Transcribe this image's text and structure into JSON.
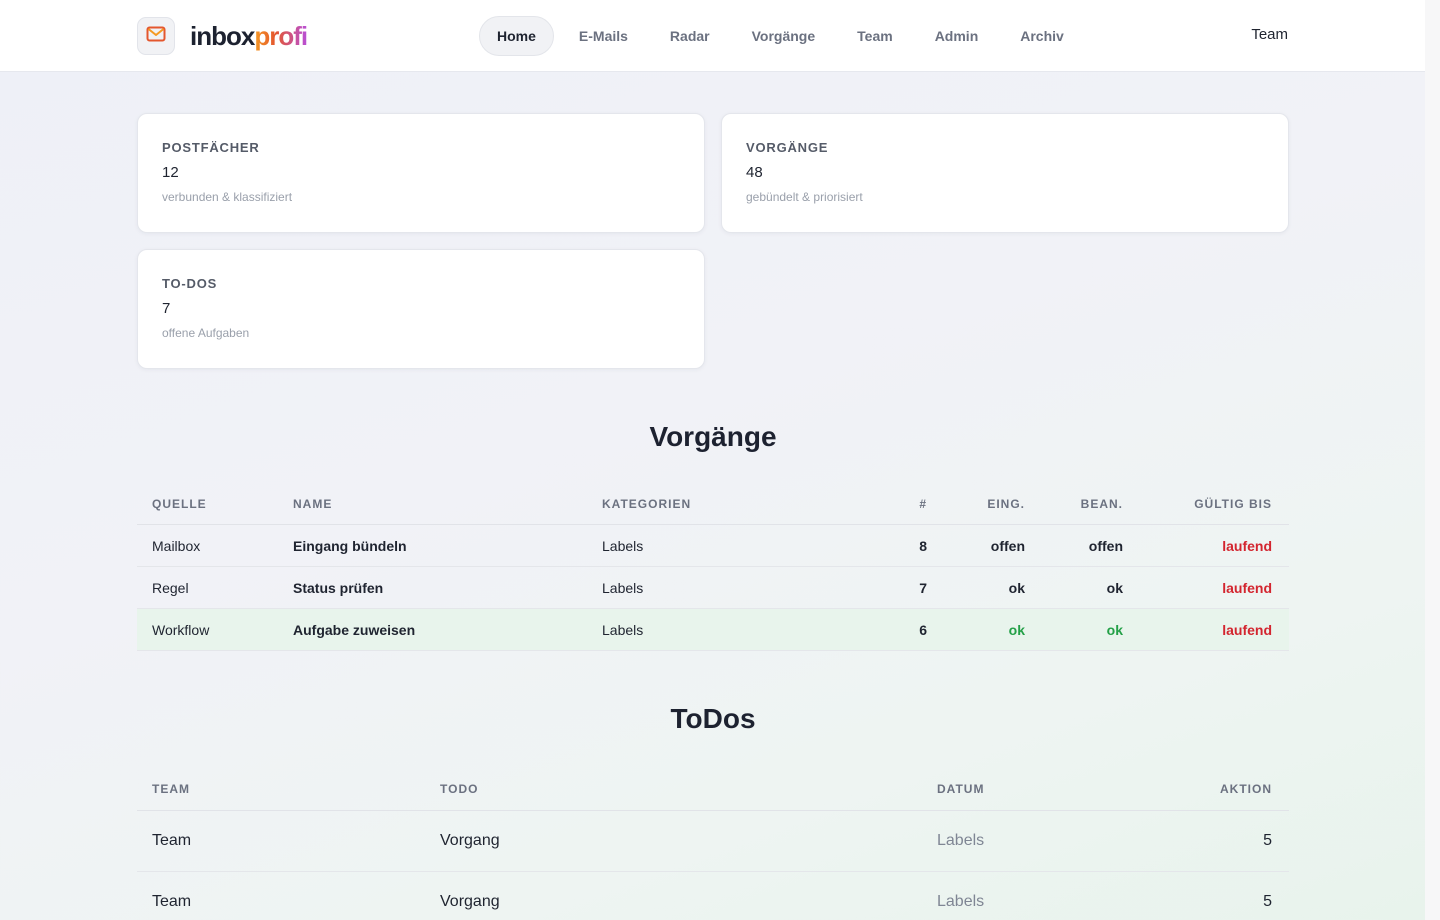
{
  "header": {
    "logo_part1": "inbox",
    "logo_part2": "profi",
    "nav": [
      "Home",
      "E-Mails",
      "Radar",
      "Vorgänge",
      "Team",
      "Admin",
      "Archiv"
    ],
    "active_nav": "Home",
    "right_link": "Team"
  },
  "icons": {
    "logo": "mail-icon"
  },
  "colors": {
    "accent_red": "#d3252f",
    "accent_green": "#23a047",
    "highlight_row": "#e8f4ec"
  },
  "cards": [
    {
      "title": "POSTFÄCHER",
      "value": "12",
      "subtitle": "verbunden & klassifiziert"
    },
    {
      "title": "VORGÄNGE",
      "value": "48",
      "subtitle": "gebündelt & priorisiert"
    },
    {
      "title": "TO-DOS",
      "value": "7",
      "subtitle": "offene Aufgaben"
    }
  ],
  "vorgaenge": {
    "title": "Vorgänge",
    "columns": [
      "QUELLE",
      "NAME",
      "KATEGORIEN",
      "#",
      "EING.",
      "BEAN.",
      "GÜLTIG BIS"
    ],
    "rows": [
      {
        "quelle": "Mailbox",
        "name": "Eingang bündeln",
        "kategorien": "Labels",
        "count": "8",
        "eing": "offen",
        "bean": "offen",
        "gueltig": "laufend"
      },
      {
        "quelle": "Regel",
        "name": "Status prüfen",
        "kategorien": "Labels",
        "count": "7",
        "eing": "ok",
        "bean": "ok",
        "gueltig": "laufend"
      },
      {
        "quelle": "Workflow",
        "name": "Aufgabe zuweisen",
        "kategorien": "Labels",
        "count": "6",
        "eing": "ok",
        "bean": "ok",
        "gueltig": "laufend"
      }
    ]
  },
  "todos": {
    "title": "ToDos",
    "columns": [
      "TEAM",
      "TODO",
      "DATUM",
      "AKTION"
    ],
    "rows": [
      {
        "team": "Team",
        "todo": "Vorgang",
        "datum": "Labels",
        "aktion": "5"
      },
      {
        "team": "Team",
        "todo": "Vorgang",
        "datum": "Labels",
        "aktion": "5"
      }
    ]
  }
}
